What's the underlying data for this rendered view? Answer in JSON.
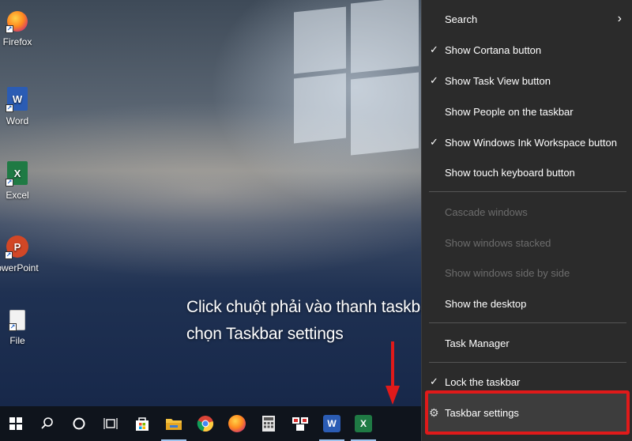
{
  "desktop_icons": [
    {
      "label": "Firefox",
      "icon": "firefox-icon"
    },
    {
      "label": "Word",
      "icon": "word-icon"
    },
    {
      "label": "Excel",
      "icon": "excel-icon"
    },
    {
      "label": "owerPoint",
      "icon": "powerpoint-icon"
    },
    {
      "label": "File",
      "icon": "file-icon"
    }
  ],
  "caption": {
    "line1": "Click chuột phải vào thanh taskbar",
    "line2": "chọn Taskbar settings"
  },
  "context_menu": {
    "items": [
      {
        "label": "Search",
        "checked": false,
        "disabled": false,
        "submenu": true
      },
      {
        "label": "Show Cortana button",
        "checked": true,
        "disabled": false
      },
      {
        "label": "Show Task View button",
        "checked": true,
        "disabled": false
      },
      {
        "label": "Show People on the taskbar",
        "checked": false,
        "disabled": false
      },
      {
        "label": "Show Windows Ink Workspace button",
        "checked": true,
        "disabled": false
      },
      {
        "label": "Show touch keyboard button",
        "checked": false,
        "disabled": false
      },
      {
        "label": "Cascade windows",
        "checked": false,
        "disabled": true
      },
      {
        "label": "Show windows stacked",
        "checked": false,
        "disabled": true
      },
      {
        "label": "Show windows side by side",
        "checked": false,
        "disabled": true
      },
      {
        "label": "Show the desktop",
        "checked": false,
        "disabled": false
      },
      {
        "label": "Task Manager",
        "checked": false,
        "disabled": false
      },
      {
        "label": "Lock the taskbar",
        "checked": true,
        "disabled": false
      },
      {
        "label": "Taskbar settings",
        "checked": false,
        "disabled": false,
        "highlighted": true
      }
    ]
  },
  "taskbar": {
    "buttons": [
      "start-icon",
      "search-icon",
      "cortana-icon",
      "task-view-icon",
      "store-icon",
      "file-explorer-icon",
      "chrome-icon",
      "firefox-icon",
      "calculator-icon",
      "snipping-icon",
      "word-icon",
      "excel-icon"
    ]
  },
  "colors": {
    "highlight_border": "#e01a1a",
    "menu_bg": "#2b2b2b",
    "taskbar_bg": "#0f141c"
  },
  "glyphs": {
    "check": "✓",
    "chevron": "›",
    "gear": "⚙",
    "word": "W",
    "excel": "X",
    "powerpoint": "P"
  }
}
